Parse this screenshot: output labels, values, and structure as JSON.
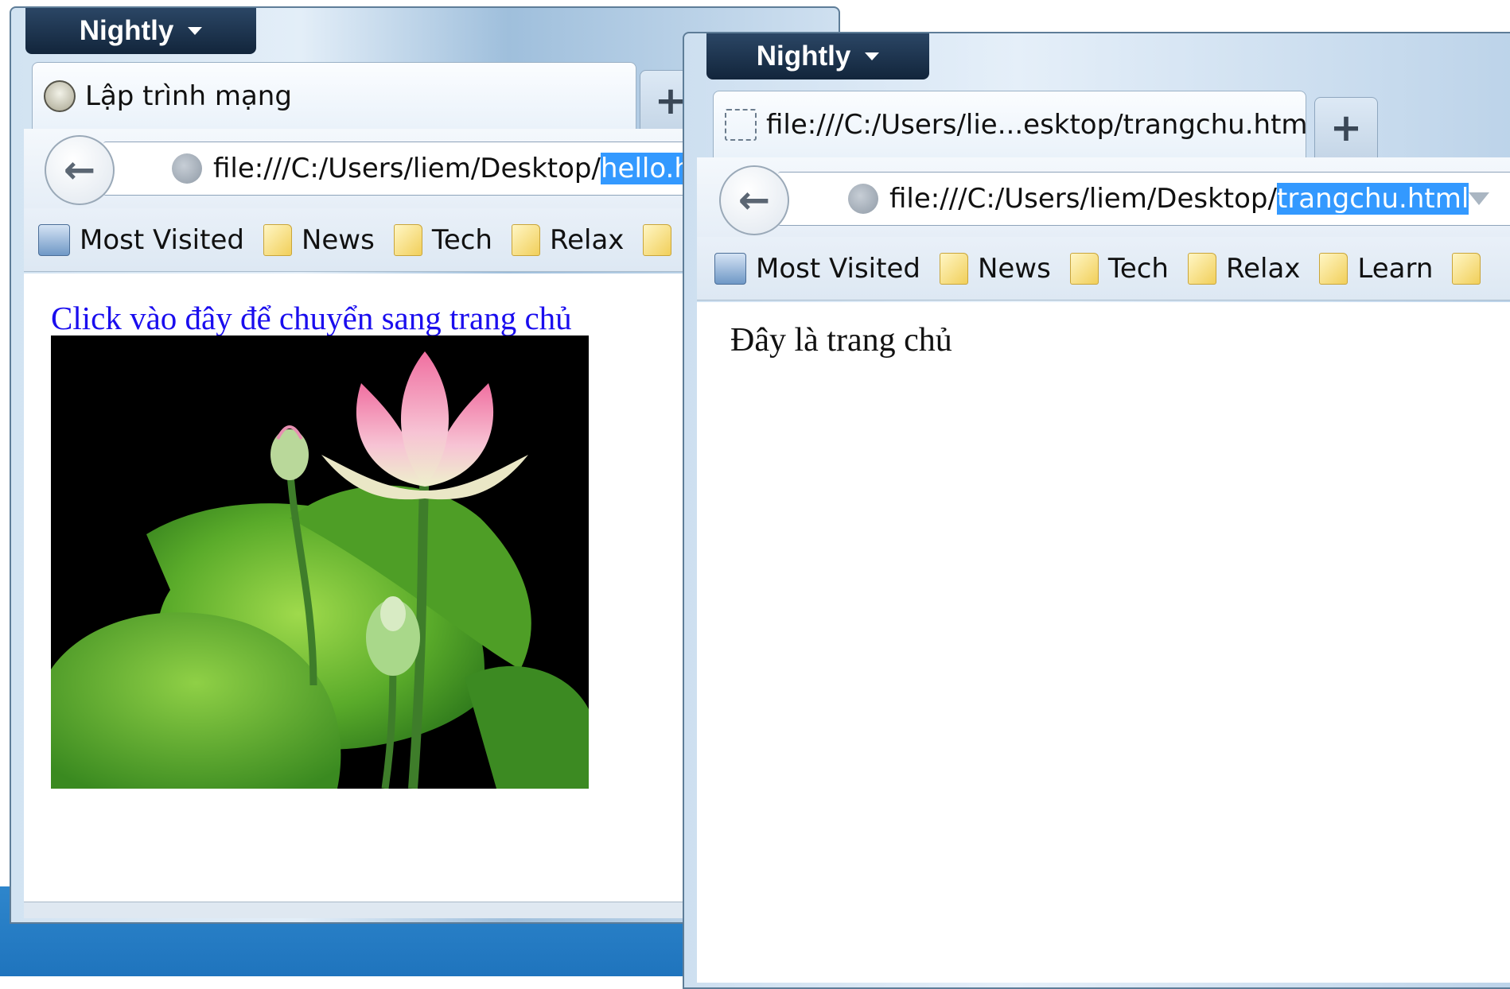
{
  "window_left": {
    "app_menu": "Nightly",
    "tab_title": "Lập trình mạng",
    "new_tab": "+",
    "url_base": "file:///C:/Users/liem/Desktop/",
    "url_selected": "hello.html",
    "bookmarks": [
      "Most Visited",
      "News",
      "Tech",
      "Relax"
    ],
    "link_text": "Click vào đây để chuyển sang trang chủ"
  },
  "window_right": {
    "app_menu": "Nightly",
    "tab_title": "file:///C:/Users/lie...esktop/trangchu.html",
    "new_tab": "+",
    "url_base": "file:///C:/Users/liem/Desktop/",
    "url_selected": "trangchu.html",
    "bookmarks": [
      "Most Visited",
      "News",
      "Tech",
      "Relax",
      "Learn"
    ],
    "page_text": "Đây là trang chủ"
  },
  "icons": {
    "back": "back-arrow-icon",
    "site": "globe-icon",
    "folder": "folder-icon",
    "reload": "reload-icon"
  },
  "colors": {
    "selection": "#3399ff",
    "link": "#1a0dee",
    "nightly_menu": "#1d334d"
  }
}
